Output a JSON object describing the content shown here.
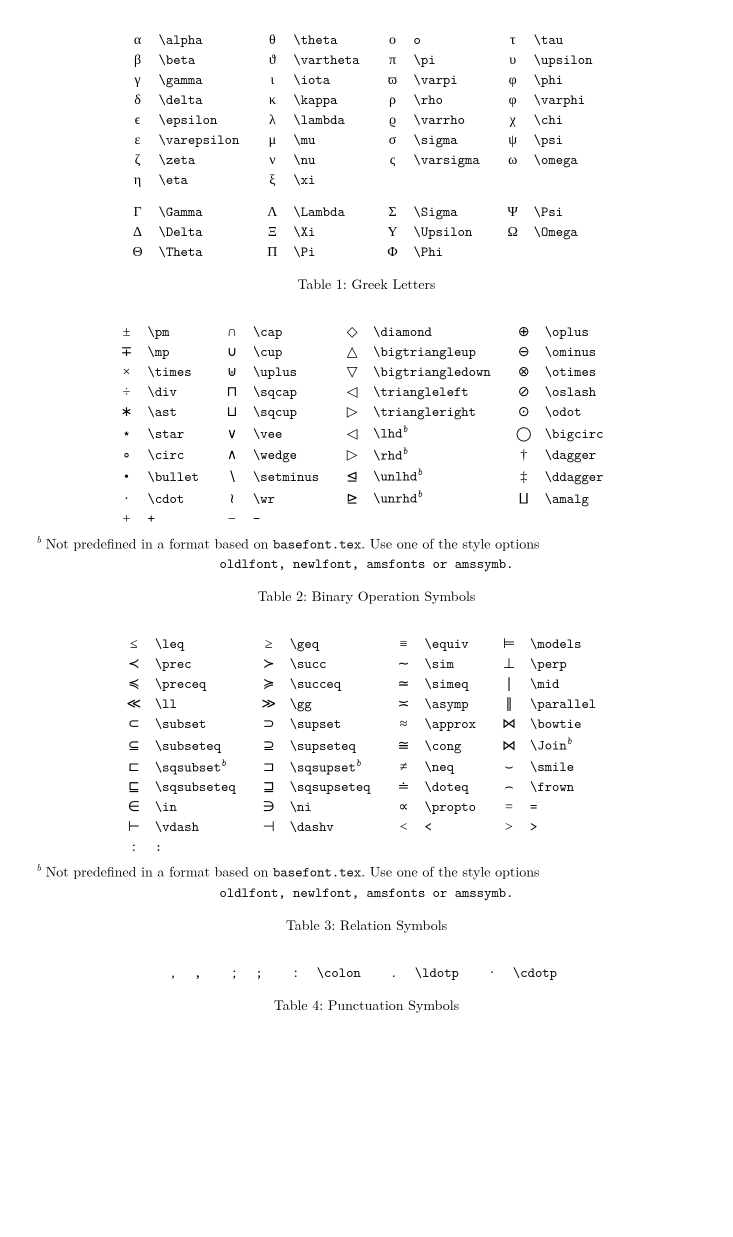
{
  "tables": [
    {
      "caption": "Table 1: Greek Letters",
      "cols": 4,
      "rows": [
        [
          {
            "s": "α",
            "c": "\\alpha"
          },
          {
            "s": "θ",
            "c": "\\theta"
          },
          {
            "s": "o",
            "c": "o"
          },
          {
            "s": "τ",
            "c": "\\tau"
          }
        ],
        [
          {
            "s": "β",
            "c": "\\beta"
          },
          {
            "s": "ϑ",
            "c": "\\vartheta"
          },
          {
            "s": "π",
            "c": "\\pi"
          },
          {
            "s": "υ",
            "c": "\\upsilon"
          }
        ],
        [
          {
            "s": "γ",
            "c": "\\gamma"
          },
          {
            "s": "ι",
            "c": "\\iota"
          },
          {
            "s": "ϖ",
            "c": "\\varpi"
          },
          {
            "s": "φ",
            "c": "\\phi"
          }
        ],
        [
          {
            "s": "δ",
            "c": "\\delta"
          },
          {
            "s": "κ",
            "c": "\\kappa"
          },
          {
            "s": "ρ",
            "c": "\\rho"
          },
          {
            "s": "φ",
            "c": "\\varphi"
          }
        ],
        [
          {
            "s": "ϵ",
            "c": "\\epsilon"
          },
          {
            "s": "λ",
            "c": "\\lambda"
          },
          {
            "s": "ϱ",
            "c": "\\varrho"
          },
          {
            "s": "χ",
            "c": "\\chi"
          }
        ],
        [
          {
            "s": "ε",
            "c": "\\varepsilon"
          },
          {
            "s": "μ",
            "c": "\\mu"
          },
          {
            "s": "σ",
            "c": "\\sigma"
          },
          {
            "s": "ψ",
            "c": "\\psi"
          }
        ],
        [
          {
            "s": "ζ",
            "c": "\\zeta"
          },
          {
            "s": "ν",
            "c": "\\nu"
          },
          {
            "s": "ς",
            "c": "\\varsigma"
          },
          {
            "s": "ω",
            "c": "\\omega"
          }
        ],
        [
          {
            "s": "η",
            "c": "\\eta"
          },
          {
            "s": "ξ",
            "c": "\\xi"
          },
          null,
          null
        ],
        "spacer",
        [
          {
            "s": "Γ",
            "c": "\\Gamma"
          },
          {
            "s": "Λ",
            "c": "\\Lambda"
          },
          {
            "s": "Σ",
            "c": "\\Sigma"
          },
          {
            "s": "Ψ",
            "c": "\\Psi"
          }
        ],
        [
          {
            "s": "Δ",
            "c": "\\Delta"
          },
          {
            "s": "Ξ",
            "c": "\\Xi"
          },
          {
            "s": "Υ",
            "c": "\\Upsilon"
          },
          {
            "s": "Ω",
            "c": "\\Omega"
          }
        ],
        [
          {
            "s": "Θ",
            "c": "\\Theta"
          },
          {
            "s": "Π",
            "c": "\\Pi"
          },
          {
            "s": "Φ",
            "c": "\\Phi"
          },
          null
        ]
      ]
    },
    {
      "caption": "Table 2: Binary Operation Symbols",
      "cols": 4,
      "footnote": true,
      "rows": [
        [
          {
            "s": "±",
            "c": "\\pm"
          },
          {
            "s": "∩",
            "c": "\\cap"
          },
          {
            "s": "◇",
            "c": "\\diamond"
          },
          {
            "s": "⊕",
            "c": "\\oplus"
          }
        ],
        [
          {
            "s": "∓",
            "c": "\\mp"
          },
          {
            "s": "∪",
            "c": "\\cup"
          },
          {
            "s": "△",
            "c": "\\bigtriangleup"
          },
          {
            "s": "⊖",
            "c": "\\ominus"
          }
        ],
        [
          {
            "s": "×",
            "c": "\\times"
          },
          {
            "s": "⊎",
            "c": "\\uplus"
          },
          {
            "s": "▽",
            "c": "\\bigtriangledown"
          },
          {
            "s": "⊗",
            "c": "\\otimes"
          }
        ],
        [
          {
            "s": "÷",
            "c": "\\div"
          },
          {
            "s": "⊓",
            "c": "\\sqcap"
          },
          {
            "s": "◁",
            "c": "\\triangleleft"
          },
          {
            "s": "⊘",
            "c": "\\oslash"
          }
        ],
        [
          {
            "s": "∗",
            "c": "\\ast"
          },
          {
            "s": "⊔",
            "c": "\\sqcup"
          },
          {
            "s": "▷",
            "c": "\\triangleright"
          },
          {
            "s": "⊙",
            "c": "\\odot"
          }
        ],
        [
          {
            "s": "⋆",
            "c": "\\star"
          },
          {
            "s": "∨",
            "c": "\\vee"
          },
          {
            "s": "◁",
            "c": "\\lhd",
            "sup": "b"
          },
          {
            "s": "◯",
            "c": "\\bigcirc"
          }
        ],
        [
          {
            "s": "∘",
            "c": "\\circ"
          },
          {
            "s": "∧",
            "c": "\\wedge"
          },
          {
            "s": "▷",
            "c": "\\rhd",
            "sup": "b"
          },
          {
            "s": "†",
            "c": "\\dagger"
          }
        ],
        [
          {
            "s": "•",
            "c": "\\bullet"
          },
          {
            "s": "∖",
            "c": "\\setminus"
          },
          {
            "s": "⊴",
            "c": "\\unlhd",
            "sup": "b"
          },
          {
            "s": "‡",
            "c": "\\ddagger"
          }
        ],
        [
          {
            "s": "·",
            "c": "\\cdot"
          },
          {
            "s": "≀",
            "c": "\\wr"
          },
          {
            "s": "⊵",
            "c": "\\unrhd",
            "sup": "b"
          },
          {
            "s": "⨿",
            "c": "\\amalg"
          }
        ],
        [
          {
            "s": "+",
            "c": "+"
          },
          {
            "s": "−",
            "c": "-"
          },
          null,
          null
        ]
      ]
    },
    {
      "caption": "Table 3: Relation Symbols",
      "cols": 4,
      "footnote": true,
      "rows": [
        [
          {
            "s": "≤",
            "c": "\\leq"
          },
          {
            "s": "≥",
            "c": "\\geq"
          },
          {
            "s": "≡",
            "c": "\\equiv"
          },
          {
            "s": "⊨",
            "c": "\\models"
          }
        ],
        [
          {
            "s": "≺",
            "c": "\\prec"
          },
          {
            "s": "≻",
            "c": "\\succ"
          },
          {
            "s": "∼",
            "c": "\\sim"
          },
          {
            "s": "⊥",
            "c": "\\perp"
          }
        ],
        [
          {
            "s": "≼",
            "c": "\\preceq"
          },
          {
            "s": "≽",
            "c": "\\succeq"
          },
          {
            "s": "≃",
            "c": "\\simeq"
          },
          {
            "s": "∣",
            "c": "\\mid"
          }
        ],
        [
          {
            "s": "≪",
            "c": "\\ll"
          },
          {
            "s": "≫",
            "c": "\\gg"
          },
          {
            "s": "≍",
            "c": "\\asymp"
          },
          {
            "s": "∥",
            "c": "\\parallel"
          }
        ],
        [
          {
            "s": "⊂",
            "c": "\\subset"
          },
          {
            "s": "⊃",
            "c": "\\supset"
          },
          {
            "s": "≈",
            "c": "\\approx"
          },
          {
            "s": "⋈",
            "c": "\\bowtie"
          }
        ],
        [
          {
            "s": "⊆",
            "c": "\\subseteq"
          },
          {
            "s": "⊇",
            "c": "\\supseteq"
          },
          {
            "s": "≅",
            "c": "\\cong"
          },
          {
            "s": "⋈",
            "c": "\\Join",
            "sup": "b"
          }
        ],
        [
          {
            "s": "⊏",
            "c": "\\sqsubset",
            "sup": "b"
          },
          {
            "s": "⊐",
            "c": "\\sqsupset",
            "sup": "b"
          },
          {
            "s": "≠",
            "c": "\\neq"
          },
          {
            "s": "⌣",
            "c": "\\smile"
          }
        ],
        [
          {
            "s": "⊑",
            "c": "\\sqsubseteq"
          },
          {
            "s": "⊒",
            "c": "\\sqsupseteq"
          },
          {
            "s": "≐",
            "c": "\\doteq"
          },
          {
            "s": "⌢",
            "c": "\\frown"
          }
        ],
        [
          {
            "s": "∈",
            "c": "\\in"
          },
          {
            "s": "∋",
            "c": "\\ni"
          },
          {
            "s": "∝",
            "c": "\\propto"
          },
          {
            "s": "=",
            "c": "="
          }
        ],
        [
          {
            "s": "⊢",
            "c": "\\vdash"
          },
          {
            "s": "⊣",
            "c": "\\dashv"
          },
          {
            "s": "<",
            "c": "<"
          },
          {
            "s": ">",
            "c": ">"
          }
        ],
        [
          {
            "s": ":",
            "c": ":"
          },
          null,
          null,
          null
        ]
      ]
    },
    {
      "caption": "Table 4: Punctuation Symbols",
      "cols": 5,
      "rows": [
        [
          {
            "s": ",",
            "c": ","
          },
          {
            "s": ";",
            "c": ";"
          },
          {
            "s": ":",
            "c": "\\colon"
          },
          {
            "s": ".",
            "c": "\\ldotp"
          },
          {
            "s": "·",
            "c": "\\cdotp"
          }
        ]
      ]
    }
  ],
  "footnote_text": {
    "lead": "Not predefined in a format based on ",
    "tt1": "basefont.tex",
    "mid": ". Use one of the style options ",
    "opts": "oldlfont, newlfont, amsfonts or amssymb."
  }
}
